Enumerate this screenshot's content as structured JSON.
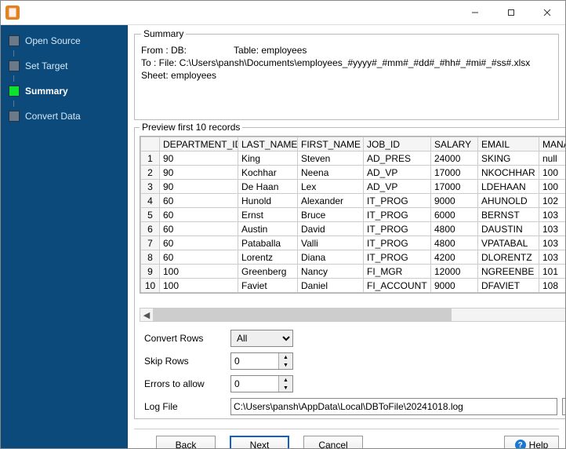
{
  "sidebar": {
    "items": [
      {
        "label": "Open Source",
        "active": false
      },
      {
        "label": "Set Target",
        "active": false
      },
      {
        "label": "Summary",
        "active": true
      },
      {
        "label": "Convert Data",
        "active": false
      }
    ]
  },
  "summary": {
    "legend": "Summary",
    "line1": "From : DB:",
    "line1b": "Table: employees",
    "line2": "To : File: C:\\Users\\pansh\\Documents\\employees_#yyyy#_#mm#_#dd#_#hh#_#mi#_#ss#.xlsx Sheet: employees"
  },
  "preview": {
    "legend": "Preview first 10 records",
    "columns": [
      "DEPARTMENT_ID",
      "LAST_NAME",
      "FIRST_NAME",
      "JOB_ID",
      "SALARY",
      "EMAIL",
      "MANAG"
    ],
    "rows": [
      [
        "90",
        "King",
        "Steven",
        "AD_PRES",
        "24000",
        "SKING",
        "null"
      ],
      [
        "90",
        "Kochhar",
        "Neena",
        "AD_VP",
        "17000",
        "NKOCHHAR",
        "100"
      ],
      [
        "90",
        "De Haan",
        "Lex",
        "AD_VP",
        "17000",
        "LDEHAAN",
        "100"
      ],
      [
        "60",
        "Hunold",
        "Alexander",
        "IT_PROG",
        "9000",
        "AHUNOLD",
        "102"
      ],
      [
        "60",
        "Ernst",
        "Bruce",
        "IT_PROG",
        "6000",
        "BERNST",
        "103"
      ],
      [
        "60",
        "Austin",
        "David",
        "IT_PROG",
        "4800",
        "DAUSTIN",
        "103"
      ],
      [
        "60",
        "Pataballa",
        "Valli",
        "IT_PROG",
        "4800",
        "VPATABAL",
        "103"
      ],
      [
        "60",
        "Lorentz",
        "Diana",
        "IT_PROG",
        "4200",
        "DLORENTZ",
        "103"
      ],
      [
        "100",
        "Greenberg",
        "Nancy",
        "FI_MGR",
        "12000",
        "NGREENBE",
        "101"
      ],
      [
        "100",
        "Faviet",
        "Daniel",
        "FI_ACCOUNT",
        "9000",
        "DFAVIET",
        "108"
      ]
    ]
  },
  "form": {
    "convert_rows_label": "Convert Rows",
    "convert_rows_value": "All",
    "skip_rows_label": "Skip Rows",
    "skip_rows_value": "0",
    "errors_label": "Errors to allow",
    "errors_value": "0",
    "logfile_label": "Log File",
    "logfile_value": "C:\\Users\\pansh\\AppData\\Local\\DBToFile\\20241018.log"
  },
  "footer": {
    "back": "Back",
    "next": "Next",
    "cancel": "Cancel",
    "help": "Help"
  }
}
